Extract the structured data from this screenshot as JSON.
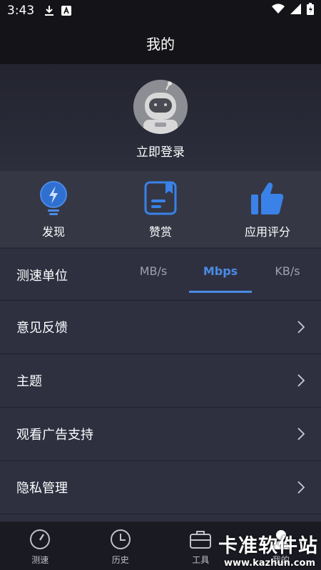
{
  "status_bar": {
    "time": "3:43",
    "icons": [
      "download-icon",
      "font-icon",
      "wifi-icon",
      "signal-icon",
      "battery-icon"
    ]
  },
  "header": {
    "title": "我的"
  },
  "profile": {
    "login_label": "立即登录",
    "avatar_icon": "astronaut-avatar-icon"
  },
  "features": [
    {
      "label": "发现",
      "icon": "lightning-bulb-icon"
    },
    {
      "label": "赞赏",
      "icon": "notebook-icon"
    },
    {
      "label": "应用评分",
      "icon": "thumbs-up-icon"
    }
  ],
  "speed_unit": {
    "label": "测速单位",
    "options": [
      "MB/s",
      "Mbps",
      "KB/s"
    ],
    "selected": "Mbps"
  },
  "menu": [
    {
      "label": "意见反馈"
    },
    {
      "label": "主题"
    },
    {
      "label": "观看广告支持"
    },
    {
      "label": "隐私管理"
    }
  ],
  "tab_bar": [
    {
      "label": "测速",
      "icon": "gauge-icon"
    },
    {
      "label": "历史",
      "icon": "clock-icon"
    },
    {
      "label": "工具",
      "icon": "toolbox-icon"
    },
    {
      "label": "我的",
      "icon": "person-icon"
    }
  ],
  "watermark": {
    "line1": "卡准软件站",
    "line2": "www.kazhun.com"
  },
  "colors": {
    "accent": "#4b8be4",
    "background": "#2e3040",
    "header": "#141418"
  }
}
